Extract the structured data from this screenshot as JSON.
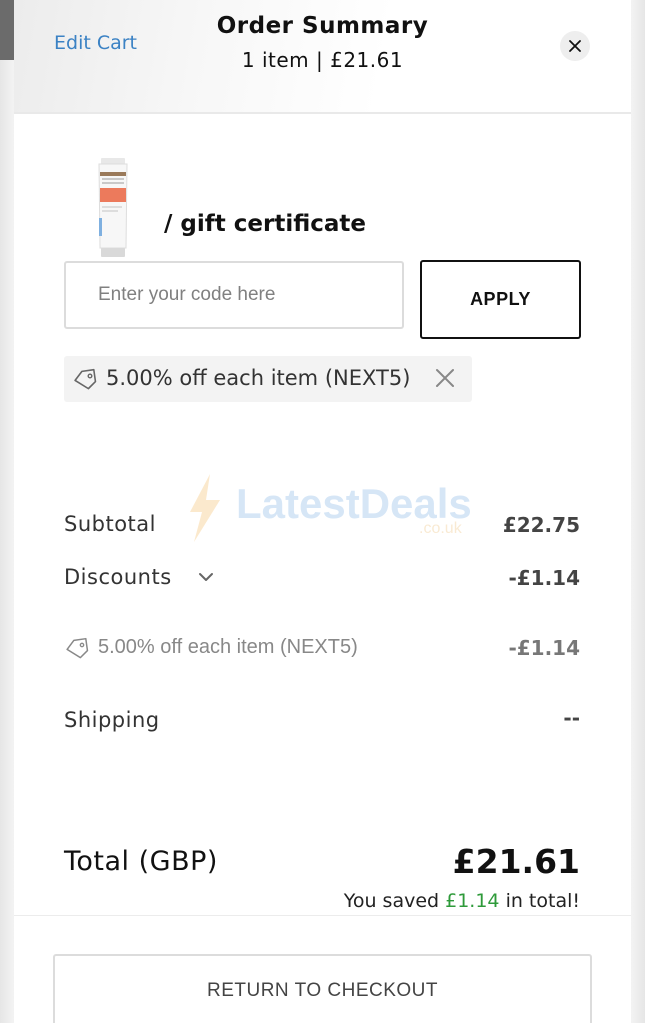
{
  "header": {
    "edit_cart": "Edit Cart",
    "title": "Order Summary",
    "subtitle": "1 item | £21.61",
    "close_icon": "close-icon"
  },
  "product": {
    "image_icon": "product-tube-image",
    "label": "/ gift certificate"
  },
  "promo": {
    "placeholder": "Enter your code here",
    "value": "",
    "apply_label": "APPLY",
    "applied_chip": "5.00% off each item (NEXT5)",
    "tag_icon": "tag-icon",
    "remove_icon": "remove-icon"
  },
  "watermark": {
    "main": "LatestDeals",
    "sub": ".co.uk"
  },
  "summary": {
    "subtotal_label": "Subtotal",
    "subtotal_value": "£22.75",
    "discounts_label": "Discounts",
    "discounts_value": "-£1.14",
    "discount_item_label": "5.00% off each item (NEXT5)",
    "discount_item_value": "-£1.14",
    "shipping_label": "Shipping",
    "shipping_value": "--",
    "total_label": "Total (GBP)",
    "total_value": "£21.61",
    "saved_prefix": "You saved ",
    "saved_amount": "£1.14",
    "saved_suffix": " in total!"
  },
  "footer": {
    "return_label": "RETURN TO CHECKOUT"
  },
  "colors": {
    "link": "#3b82c4",
    "savings": "#2e9a3a"
  }
}
